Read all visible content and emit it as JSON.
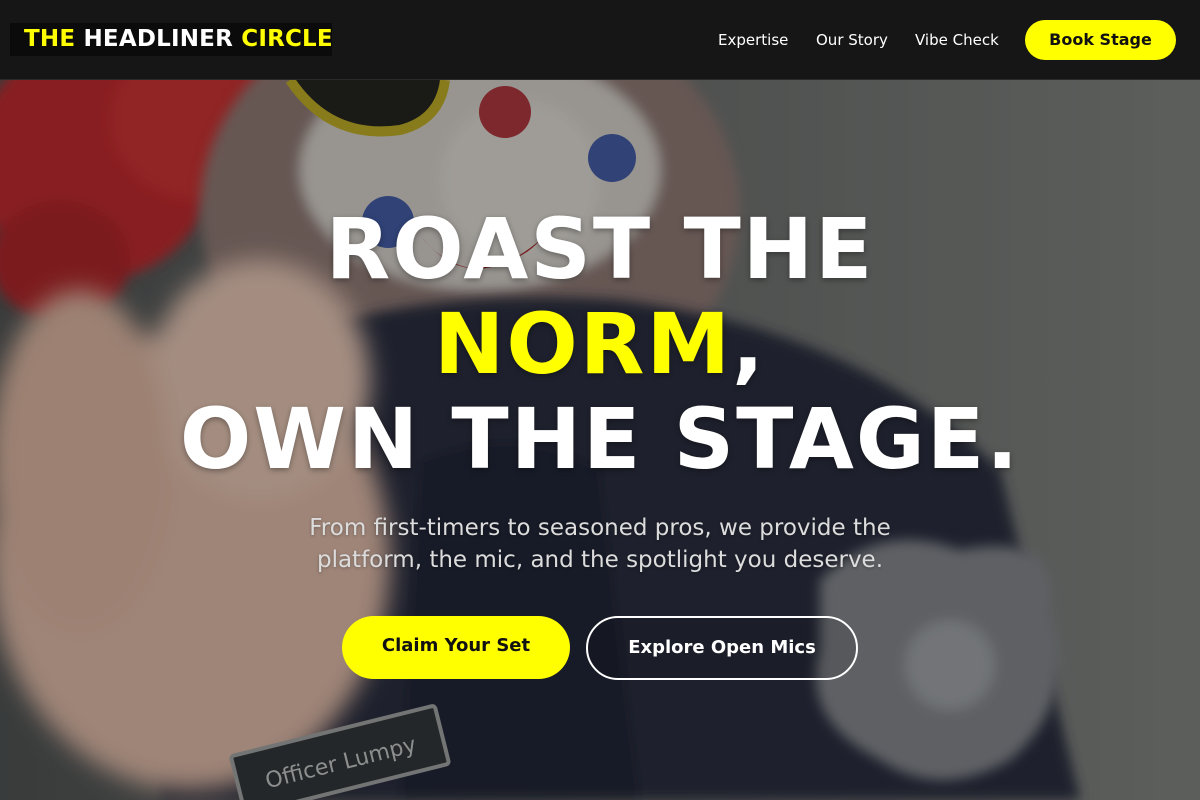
{
  "brand": {
    "part1": "THE",
    "part2": "HEADLINER",
    "part3": "CIRCLE",
    "accent_color": "#ffff00"
  },
  "nav": {
    "links": [
      "Expertise",
      "Our Story",
      "Vibe Check"
    ],
    "cta_label": "Book Stage"
  },
  "hero": {
    "headline_line1": "ROAST THE",
    "headline_accent": "NORM",
    "headline_comma": ",",
    "headline_line3": "OWN THE STAGE.",
    "subtitle": "From first-timers to seasoned pros, we provide the platform, the mic, and the spotlight you deserve.",
    "primary_cta": "Claim Your Set",
    "secondary_cta": "Explore Open Mics"
  },
  "background": {
    "name_tag_text": "Officer Lumpy"
  }
}
